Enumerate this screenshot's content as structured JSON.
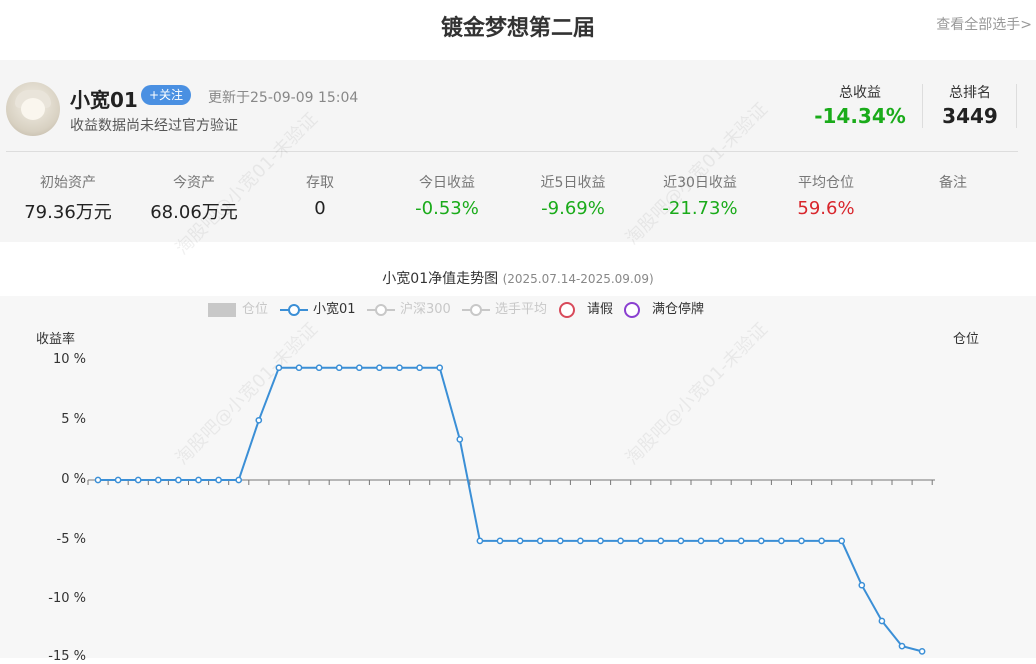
{
  "page": {
    "title": "镀金梦想第二届",
    "view_all": "查看全部选手>"
  },
  "profile": {
    "username": "小宽01",
    "follow_label": "+关注",
    "updated": "更新于25-09-09 15:04",
    "note": "收益数据尚未经过官方验证",
    "total_return_label": "总收益",
    "total_return_value": "-14.34%",
    "total_rank_label": "总排名",
    "total_rank_value": "3449"
  },
  "stats": [
    {
      "label": "初始资产",
      "value": "79.36万元"
    },
    {
      "label": "今资产",
      "value": "68.06万元"
    },
    {
      "label": "存取",
      "value": "0"
    },
    {
      "label": "今日收益",
      "value": "-0.53%"
    },
    {
      "label": "近5日收益",
      "value": "-9.69%"
    },
    {
      "label": "近30日收益",
      "value": "-21.73%"
    },
    {
      "label": "平均仓位",
      "value": "59.6%"
    },
    {
      "label": "备注",
      "value": ""
    }
  ],
  "watermark": "淘股吧@小宽01-未验证",
  "colors": {
    "green": "#1aab1a",
    "red": "#d8262c",
    "line": "#3b8fd6",
    "follow_bg": "#4a90e2"
  },
  "chart": {
    "title": "小宽01净值走势图",
    "range": "(2025.07.14-2025.09.09)",
    "legend": [
      {
        "label": "仓位",
        "icon": "grey-rect-icon",
        "color": "#c8c8c8",
        "active": false
      },
      {
        "label": "小宽01",
        "icon": "line-circle-icon",
        "color": "#3b8fd6",
        "active": true
      },
      {
        "label": "沪深300",
        "icon": "line-circle-icon",
        "color": "#c8c8c8",
        "active": false
      },
      {
        "label": "选手平均",
        "icon": "line-circle-icon",
        "color": "#c8c8c8",
        "active": false
      },
      {
        "label": "请假",
        "icon": "red-circle-icon",
        "color": "#d84a5a",
        "active": true
      },
      {
        "label": "满仓停牌",
        "icon": "purple-circle-icon",
        "color": "#8a3fd0",
        "active": true
      }
    ],
    "y_axis_name": "收益率",
    "y2_axis_name": "仓位",
    "y_ticks": [
      "10 %",
      "5 %",
      "0 %",
      "-5 %",
      "-10 %",
      "-15 %"
    ]
  },
  "chart_data": {
    "type": "line",
    "title": "小宽01净值走势图",
    "subtitle": "(2025.07.14-2025.09.09)",
    "ylabel": "收益率",
    "y2label": "仓位",
    "ylim": [
      -15,
      10
    ],
    "y_ticks": [
      10,
      5,
      0,
      -5,
      -10,
      -15
    ],
    "legend_position": "top",
    "grid": false,
    "series": [
      {
        "name": "小宽01",
        "values": [
          0,
          0,
          0,
          0,
          0,
          0,
          0,
          0,
          5,
          9.4,
          9.4,
          9.4,
          9.4,
          9.4,
          9.4,
          9.4,
          9.4,
          9.4,
          3.4,
          -5.1,
          -5.1,
          -5.1,
          -5.1,
          -5.1,
          -5.1,
          -5.1,
          -5.1,
          -5.1,
          -5.1,
          -5.1,
          -5.1,
          -5.1,
          -5.1,
          -5.1,
          -5.1,
          -5.1,
          -5.1,
          -5.1,
          -8.8,
          -11.8,
          -13.9,
          -14.34
        ]
      }
    ]
  }
}
